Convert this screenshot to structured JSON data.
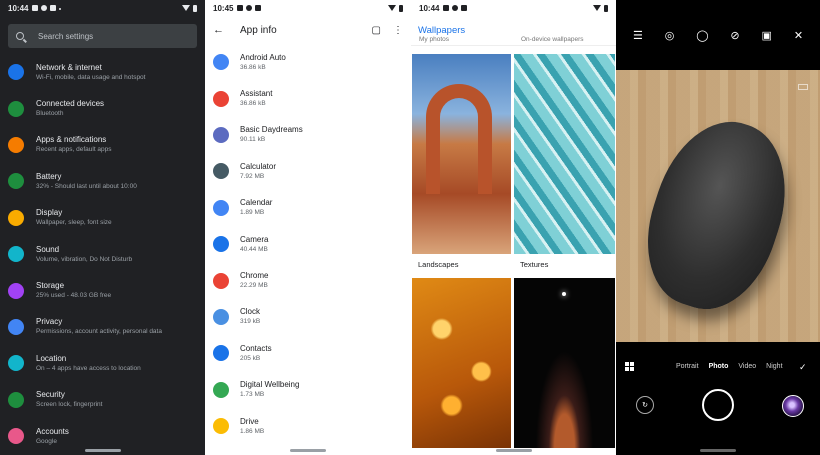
{
  "settings": {
    "status_time": "10:44",
    "search_placeholder": "Search settings",
    "items": [
      {
        "title": "Network & internet",
        "subtitle": "Wi-Fi, mobile, data usage and hotspot",
        "icon": "wifi-icon",
        "color": "#1a73e8"
      },
      {
        "title": "Connected devices",
        "subtitle": "Bluetooth",
        "icon": "devices-icon",
        "color": "#1e8e3e"
      },
      {
        "title": "Apps & notifications",
        "subtitle": "Recent apps, default apps",
        "icon": "apps-icon",
        "color": "#f57c00"
      },
      {
        "title": "Battery",
        "subtitle": "32% - Should last until about 10:00",
        "icon": "battery-icon",
        "color": "#1e8e3e"
      },
      {
        "title": "Display",
        "subtitle": "Wallpaper, sleep, font size",
        "icon": "brightness-icon",
        "color": "#f9ab00"
      },
      {
        "title": "Sound",
        "subtitle": "Volume, vibration, Do Not Disturb",
        "icon": "volume-icon",
        "color": "#12b5cb"
      },
      {
        "title": "Storage",
        "subtitle": "25% used - 48.03 GB free",
        "icon": "storage-icon",
        "color": "#a142f4"
      },
      {
        "title": "Privacy",
        "subtitle": "Permissions, account activity, personal data",
        "icon": "privacy-icon",
        "color": "#4285f4"
      },
      {
        "title": "Location",
        "subtitle": "On – 4 apps have access to location",
        "icon": "location-icon",
        "color": "#12b5cb"
      },
      {
        "title": "Security",
        "subtitle": "Screen lock, fingerprint",
        "icon": "lock-icon",
        "color": "#1e8e3e"
      },
      {
        "title": "Accounts",
        "subtitle": "Google",
        "icon": "accounts-icon",
        "color": "#e8588a"
      }
    ]
  },
  "appinfo": {
    "status_time": "10:45",
    "title": "App info",
    "apps": [
      {
        "name": "Android Auto",
        "size": "36.86 kB",
        "icon": "android-auto-icon",
        "color": "#4285f4"
      },
      {
        "name": "Assistant",
        "size": "36.86 kB",
        "icon": "assistant-icon",
        "color": "#ea4335"
      },
      {
        "name": "Basic Daydreams",
        "size": "90.11 kB",
        "icon": "android-icon",
        "color": "#5c6bc0"
      },
      {
        "name": "Calculator",
        "size": "7.92 MB",
        "icon": "calculator-icon",
        "color": "#455a64"
      },
      {
        "name": "Calendar",
        "size": "1.89 MB",
        "icon": "calendar-icon",
        "color": "#4285f4"
      },
      {
        "name": "Camera",
        "size": "40.44 MB",
        "icon": "camera-icon",
        "color": "#1a73e8"
      },
      {
        "name": "Chrome",
        "size": "22.29 MB",
        "icon": "chrome-icon",
        "color": "#ea4335"
      },
      {
        "name": "Clock",
        "size": "319 kB",
        "icon": "clock-icon",
        "color": "#4a90e2"
      },
      {
        "name": "Contacts",
        "size": "205 kB",
        "icon": "contacts-icon",
        "color": "#1a73e8"
      },
      {
        "name": "Digital Wellbeing",
        "size": "1.73 MB",
        "icon": "wellbeing-icon",
        "color": "#34a853"
      },
      {
        "name": "Drive",
        "size": "1.86 MB",
        "icon": "drive-icon",
        "color": "#fbbc04"
      }
    ]
  },
  "wallpapers": {
    "status_time": "10:44",
    "title": "Wallpapers",
    "cut_labels": [
      "My photos",
      "On-device wallpapers"
    ],
    "categories": [
      "Landscapes",
      "Textures"
    ]
  },
  "camera": {
    "modes": [
      "Portrait",
      "Photo",
      "Video",
      "Night"
    ],
    "active_mode": "Photo"
  }
}
